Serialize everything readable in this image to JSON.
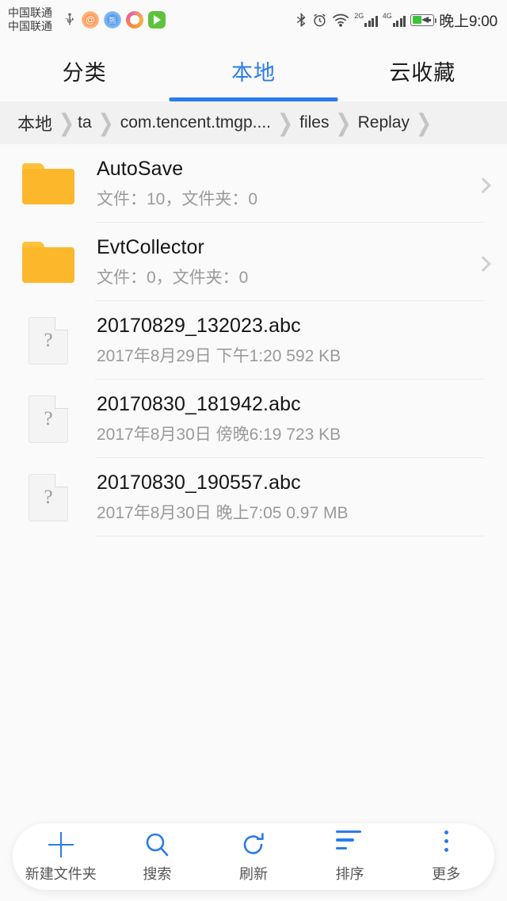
{
  "statusbar": {
    "carrier_line1": "中国联通",
    "carrier_line2": "中国联通",
    "app_icons": [
      "usb-icon",
      "weibo-icon",
      "baidu-icon",
      "uc-browser-icon",
      "play-store-icon"
    ],
    "bluetooth": "bluetooth-icon",
    "alarm": "alarm-icon",
    "wifi": "wifi-icon",
    "sim1_network": "2G",
    "sim2_network": "4G",
    "battery": "battery-charging-icon",
    "time": "晚上9:00"
  },
  "tabs": [
    {
      "label": "分类",
      "active": false
    },
    {
      "label": "本地",
      "active": true
    },
    {
      "label": "云收藏",
      "active": false
    }
  ],
  "breadcrumb": {
    "items": [
      "本地",
      "ta",
      "com.tencent.tmgp....",
      "files",
      "Replay"
    ],
    "separator": "❯"
  },
  "list": [
    {
      "type": "folder",
      "name": "AutoSave",
      "info": "文件：10，文件夹：0",
      "icon": "folder-icon",
      "chevron": "chevron-right-icon"
    },
    {
      "type": "folder",
      "name": "EvtCollector",
      "info": "文件：0，文件夹：0",
      "icon": "folder-icon",
      "chevron": "chevron-right-icon"
    },
    {
      "type": "file",
      "name": "20170829_132023.abc",
      "info": "2017年8月29日 下午1:20 592 KB",
      "icon": "unknown-file-icon"
    },
    {
      "type": "file",
      "name": "20170830_181942.abc",
      "info": "2017年8月30日 傍晚6:19 723 KB",
      "icon": "unknown-file-icon"
    },
    {
      "type": "file",
      "name": "20170830_190557.abc",
      "info": "2017年8月30日 晚上7:05 0.97 MB",
      "icon": "unknown-file-icon"
    }
  ],
  "toolbar": [
    {
      "label": "新建文件夹",
      "icon": "plus-icon"
    },
    {
      "label": "搜索",
      "icon": "search-icon"
    },
    {
      "label": "刷新",
      "icon": "refresh-icon"
    },
    {
      "label": "排序",
      "icon": "sort-icon"
    },
    {
      "label": "更多",
      "icon": "more-vertical-icon"
    }
  ],
  "colors": {
    "accent": "#2b7ce8",
    "folder": "#fcb72b",
    "background": "#fafafa",
    "breadcrumb_bg": "#f1f1f1",
    "battery_green": "#3cc13c"
  }
}
